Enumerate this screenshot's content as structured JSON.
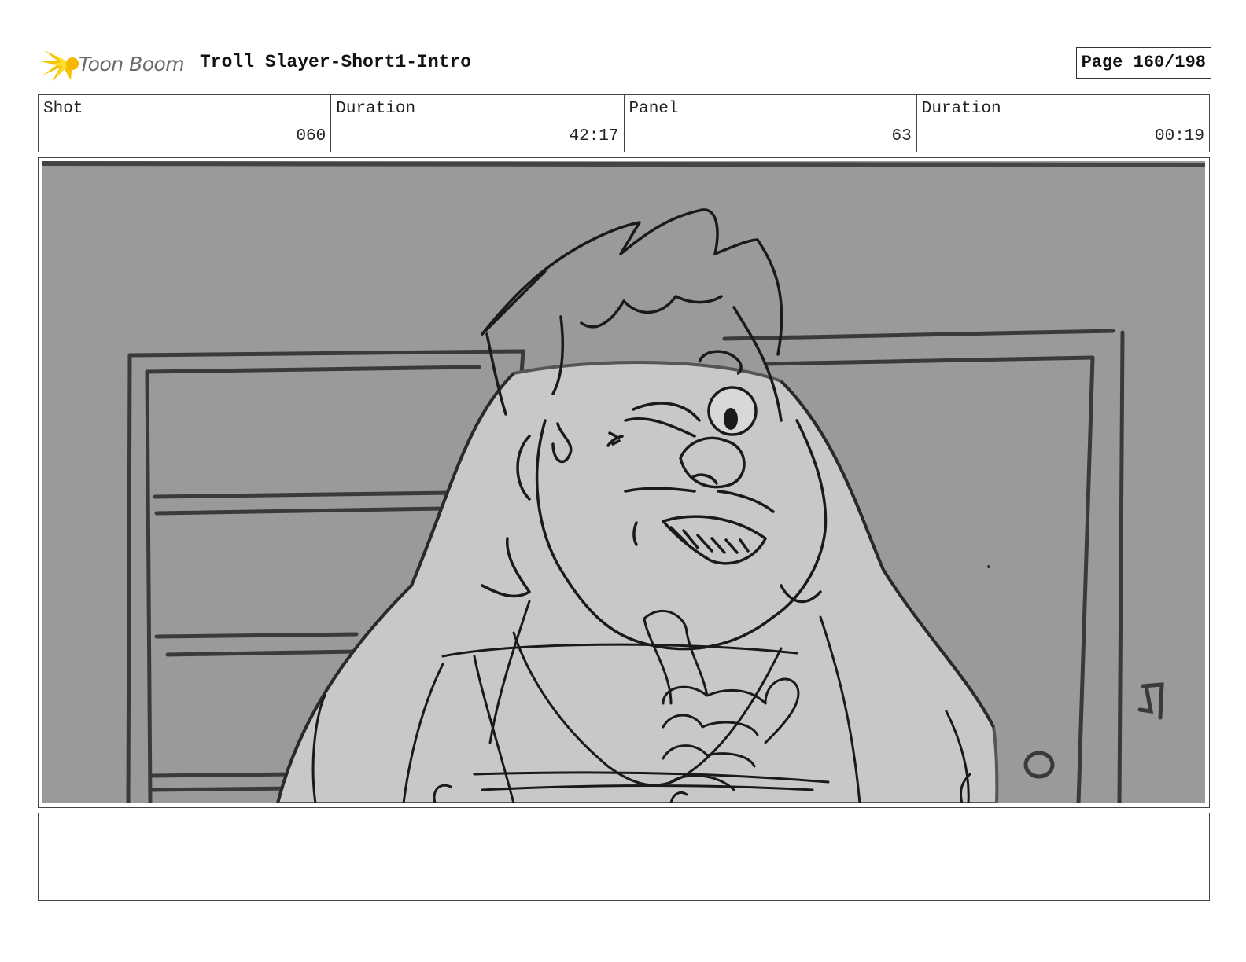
{
  "header": {
    "logo_text": "Toon Boom",
    "title": "Troll Slayer-Short1-Intro",
    "page_label": "Page 160/198"
  },
  "info": {
    "cells": [
      {
        "label": "Shot",
        "value": "060"
      },
      {
        "label": "Duration",
        "value": "42:17"
      },
      {
        "label": "Panel",
        "value": "63"
      },
      {
        "label": "Duration",
        "value": "00:19"
      }
    ]
  },
  "notes": {
    "text": ""
  },
  "colors": {
    "logo_accent": "#f5c400",
    "panel_background": "#9a9a9a",
    "character_fill": "#c8c8c8"
  }
}
